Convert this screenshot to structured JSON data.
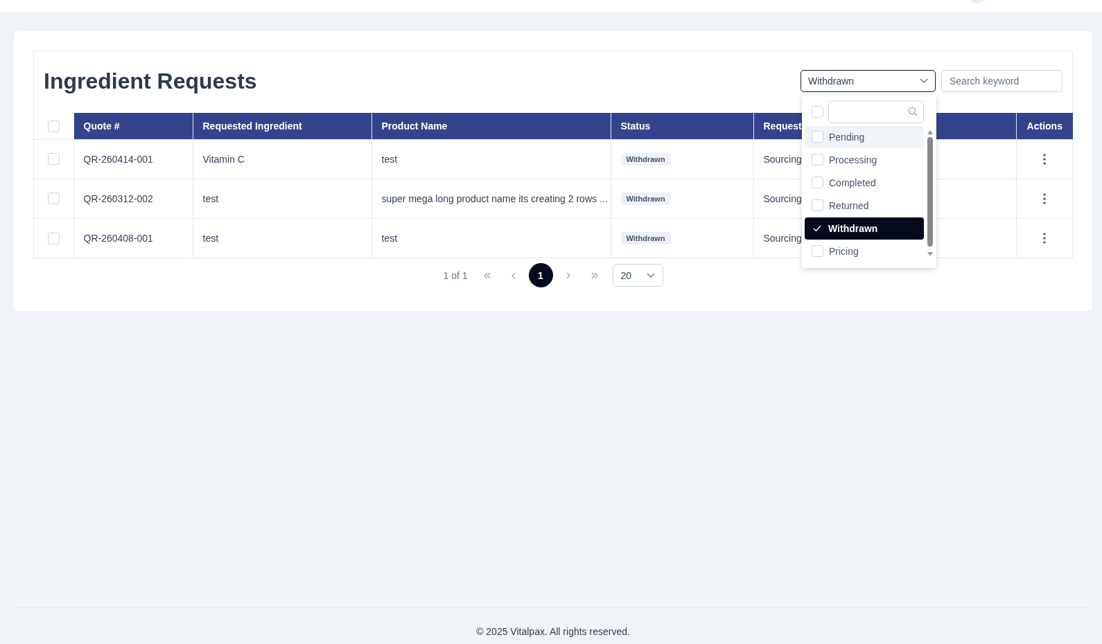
{
  "page": {
    "title": "Ingredient Requests"
  },
  "status_filter": {
    "value": "Withdrawn",
    "expanded": true,
    "select_all_checked": false,
    "options": [
      {
        "label": "Pending",
        "checked": false,
        "highlighted": true
      },
      {
        "label": "Processing",
        "checked": false,
        "highlighted": false
      },
      {
        "label": "Completed",
        "checked": false,
        "highlighted": false
      },
      {
        "label": "Returned",
        "checked": false,
        "highlighted": false
      },
      {
        "label": "Withdrawn",
        "checked": true,
        "highlighted": false
      },
      {
        "label": "Pricing",
        "checked": false,
        "highlighted": false
      }
    ]
  },
  "search": {
    "placeholder": "Search keyword"
  },
  "table": {
    "select_all_checked": false,
    "columns": [
      "Quote #",
      "Requested Ingredient",
      "Product Name",
      "Status",
      "Request",
      "Actions"
    ],
    "rows": [
      {
        "checked": false,
        "quote": "QR-260414-001",
        "ingredient": "Vitamin C",
        "product": "test",
        "status": "Withdrawn",
        "request_type": "Sourcing"
      },
      {
        "checked": false,
        "quote": "QR-260312-002",
        "ingredient": "test",
        "product": "super mega long product name its creating 2 rows ...",
        "status": "Withdrawn",
        "request_type": "Sourcing"
      },
      {
        "checked": false,
        "quote": "QR-260408-001",
        "ingredient": "test",
        "product": "test",
        "status": "Withdrawn",
        "request_type": "Sourcing"
      }
    ]
  },
  "pagination": {
    "summary": "1 of 1",
    "pages": [
      {
        "label": "1",
        "selected": true
      }
    ],
    "page_size": "20"
  },
  "footer": {
    "text": "© 2025 Vitalpax. All rights reserved."
  }
}
